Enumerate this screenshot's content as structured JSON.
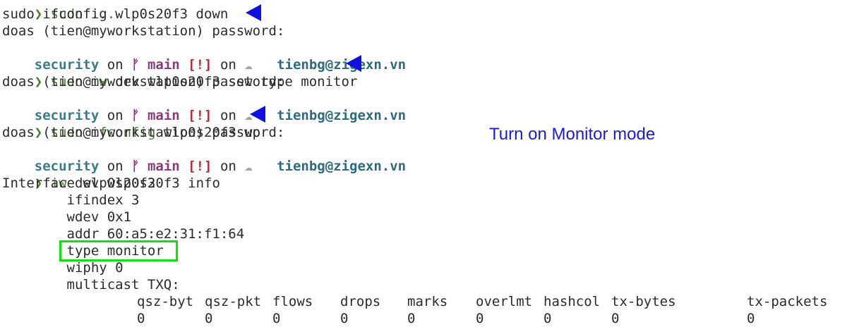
{
  "terminal": {
    "top_fragment": "❯ sudo ...",
    "lines": [
      {
        "text": "sudo ifconfig wlp0s20f3 down"
      },
      {
        "text": "doas (tien@myworkstation) password:"
      },
      {
        "prompt_ctx": {
          "dir": "security",
          "on": "on",
          "git": "",
          "branch": "main",
          "status": "[!]",
          "on2": "on",
          "cloud": "☁",
          "user": "tienbg@zigexn.vn"
        }
      },
      {
        "arrow": "❯",
        "exe": "sudo iw",
        "args": " dev wlp0s20f3 set type monitor"
      },
      {
        "text": "doas (tien@myworkstation) password:"
      },
      {
        "prompt_ctx": {
          "dir": "security",
          "on": "on",
          "git": "",
          "branch": "main",
          "status": "[!]",
          "on2": "on",
          "cloud": "☁",
          "user": "tienbg@zigexn.vn"
        }
      },
      {
        "arrow": "❯",
        "exe": "sudo ifconfig",
        "args": " wlp0s20f3 up"
      },
      {
        "text": "doas (tien@myworkstation) password:"
      },
      {
        "prompt_ctx": {
          "dir": "security",
          "on": "on",
          "git": "",
          "branch": "main",
          "status": "[!]",
          "on2": "on",
          "cloud": "☁",
          "user": "tienbg@zigexn.vn"
        }
      },
      {
        "arrow": "❯",
        "exe": "iw",
        "args": " dev wlp0s20f3 info"
      },
      {
        "text": "Interface wlp0s20f3"
      },
      {
        "text": "        ifindex 3"
      },
      {
        "text": "        wdev 0x1"
      },
      {
        "text": "        addr 60:a5:e2:31:f1:64"
      },
      {
        "text": "        type monitor"
      },
      {
        "text": "        wiphy 0"
      },
      {
        "text": "        multicast TXQ:"
      }
    ],
    "txq_headers": [
      "qsz-byt",
      "qsz-pkt",
      "flows",
      "drops",
      "marks",
      "overlmt",
      "hashcol",
      "tx-bytes",
      "tx-packets"
    ],
    "txq_values": [
      "0",
      "0",
      "0",
      "0",
      "0",
      "0",
      "0",
      "0",
      "0"
    ]
  },
  "annotation": {
    "note": "Turn on Monitor mode",
    "arrow_color": "#1010e0",
    "highlight_color": "#10e010"
  }
}
